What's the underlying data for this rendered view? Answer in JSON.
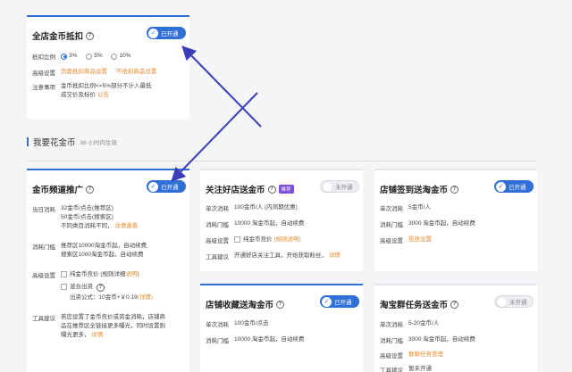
{
  "colors": {
    "accent": "#2f6fd6",
    "orange": "#e88a2d",
    "tag_purple": "#7a4dd6"
  },
  "store_card": {
    "title": "全店金币抵扣",
    "toggle": "已开通",
    "ratio_label": "抵扣比例",
    "ratio_options": [
      "3%",
      "5%",
      "10%"
    ],
    "ratio_selected": "3%",
    "advanced_label": "高级设置",
    "advanced_link1": "页面抵扣商品设置",
    "advanced_link2": "不抵扣商品设置",
    "note_label": "注意事项",
    "note_line1": "金币抵扣比例<=5%部分不计入最低",
    "note_line2": "成交价及标价",
    "note_link": "公告"
  },
  "section": {
    "title": "我要花金币",
    "subtitle": "36 小时内生效"
  },
  "channel_card": {
    "title": "金币频道推广",
    "toggle": "已开通",
    "cost_label": "当日消耗",
    "cost_line1": "32金币/点击(推荐区)",
    "cost_line2": "50金币/点击(搜索区)",
    "cost_line3": "不同类目消耗不同，",
    "cost_link": "详情查看",
    "threshold_label": "消耗门槛",
    "threshold_line1": "推荐区10000淘金币起，自动续费",
    "threshold_line2": "搜索区1000淘金币起，自动续费",
    "advanced_label": "高级设置",
    "adv_opt1": "纯金币竞价",
    "adv_opt1_note": "(规则详细",
    "adv_opt1_link": "说明",
    "adv_opt1_close": ")",
    "adv_opt2": "混合出资",
    "adv_opt2_formula": "出资公式：10金币+￥0.19",
    "adv_opt2_link": "(详情)",
    "tool_label": "工具建议",
    "tool_line1": "若您设置了金币竞价或资金消耗，店铺商",
    "tool_line2": "品在推荐区全链接更多曝光，同时设置则",
    "tool_line3": "曝光更多，",
    "tool_link": "详情"
  },
  "follow_card": {
    "title": "关注好店送金币",
    "tag": "推荐",
    "toggle": "未开通",
    "cost_label": "单次消耗",
    "cost_value": "100金币/人 (内测期优惠)",
    "threshold_label": "消耗门槛",
    "threshold_value": "10000 淘金币起，自动续费",
    "advanced_label": "高级设置",
    "adv_opt": "纯金币竞价",
    "adv_opt_link": "(规则说明)",
    "tool_label": "工具建议",
    "tool_value": "开通好店关注工具，开始获取粉丝，",
    "tool_link": "详情"
  },
  "checkin_card": {
    "title": "店铺签到送淘金币",
    "toggle": "已开通",
    "cost_label": "单次消耗",
    "cost_value": "5金币/人",
    "threshold_label": "消耗门槛",
    "threshold_value": "3000 淘金币起，自动续费",
    "advanced_label": "高级设置",
    "adv_link": "投放设置"
  },
  "favorite_card": {
    "title": "店铺收藏送淘金币",
    "toggle": "已开通",
    "cost_label": "单次消耗",
    "cost_value": "100金币/点击",
    "threshold_label": "消耗门槛",
    "threshold_value": "10000 淘金币起，自动续费"
  },
  "group_card": {
    "title": "淘宝群任务送金币",
    "toggle": "未开通",
    "cost_label": "单次消耗",
    "cost_value": "5-20金币/人",
    "threshold_label": "消耗门槛",
    "threshold_value": "3000 淘金币起，自动续费",
    "advanced_label": "高级设置",
    "adv_link": "群聊任务管理",
    "tool_label": "工具建议",
    "tool_value": "暂未开通"
  }
}
